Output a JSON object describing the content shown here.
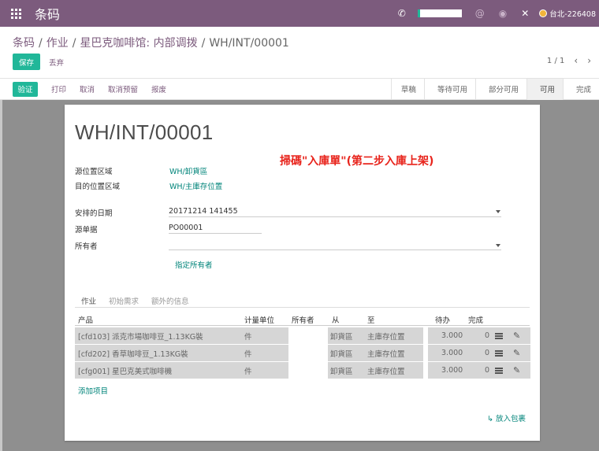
{
  "navbar": {
    "app_title": "条码",
    "user_label": "台北-226408",
    "accent_color": "#7c5b7d",
    "icons": [
      "apps-icon",
      "phone-icon",
      "at-icon",
      "chat-icon",
      "close-icon",
      "user-avatar"
    ]
  },
  "breadcrumb": {
    "items": [
      "条码",
      "作业",
      "星巴克咖啡馆: 内部调拨"
    ],
    "current": "WH/INT/00001"
  },
  "buttons": {
    "save": "保存",
    "discard": "丢弃",
    "validate": "验证"
  },
  "pager": {
    "value": "1 / 1"
  },
  "actions": [
    "打印",
    "取消",
    "取消预留",
    "报废"
  ],
  "statusbar": {
    "steps": [
      "草稿",
      "等待可用",
      "部分可用",
      "可用",
      "完成"
    ],
    "active_step": "可用"
  },
  "form": {
    "title": "WH/INT/00001",
    "annotation": "掃碼\"入庫單\"(第二步入庫上架)",
    "source_location_label": "源位置区域",
    "source_location": "WH/卸貨區",
    "dest_location_label": "目的位置区域",
    "dest_location": "WH/主庫存位置",
    "scheduled_date_label": "安排的日期",
    "scheduled_date": "20171214 141455",
    "source_doc_label": "源单据",
    "source_doc": "PO00001",
    "owner_label": "所有者",
    "owner": "",
    "assign_owner": "指定所有者"
  },
  "tabs": [
    "作业",
    "初始需求",
    "额外的信息"
  ],
  "table": {
    "headers": [
      "产品",
      "计量单位",
      "所有者",
      "从",
      "至",
      "待办",
      "完成"
    ],
    "rows": [
      {
        "product": "[cfd103] 派克市場咖啡豆_1.13KG裝",
        "uom": "件",
        "owner": "",
        "from": "卸貨區",
        "to": "主庫存位置",
        "todo": "3.000",
        "done": "0"
      },
      {
        "product": "[cfd202] 香草咖啡豆_1.13KG裝",
        "uom": "件",
        "owner": "",
        "from": "卸貨區",
        "to": "主庫存位置",
        "todo": "3.000",
        "done": "0"
      },
      {
        "product": "[cfg001] 星巴克美式咖啡機",
        "uom": "件",
        "owner": "",
        "from": "卸貨區",
        "to": "主庫存位置",
        "todo": "3.000",
        "done": "0"
      }
    ],
    "add_item": "添加项目",
    "put_in_pack": "↳ 放入包裹"
  }
}
